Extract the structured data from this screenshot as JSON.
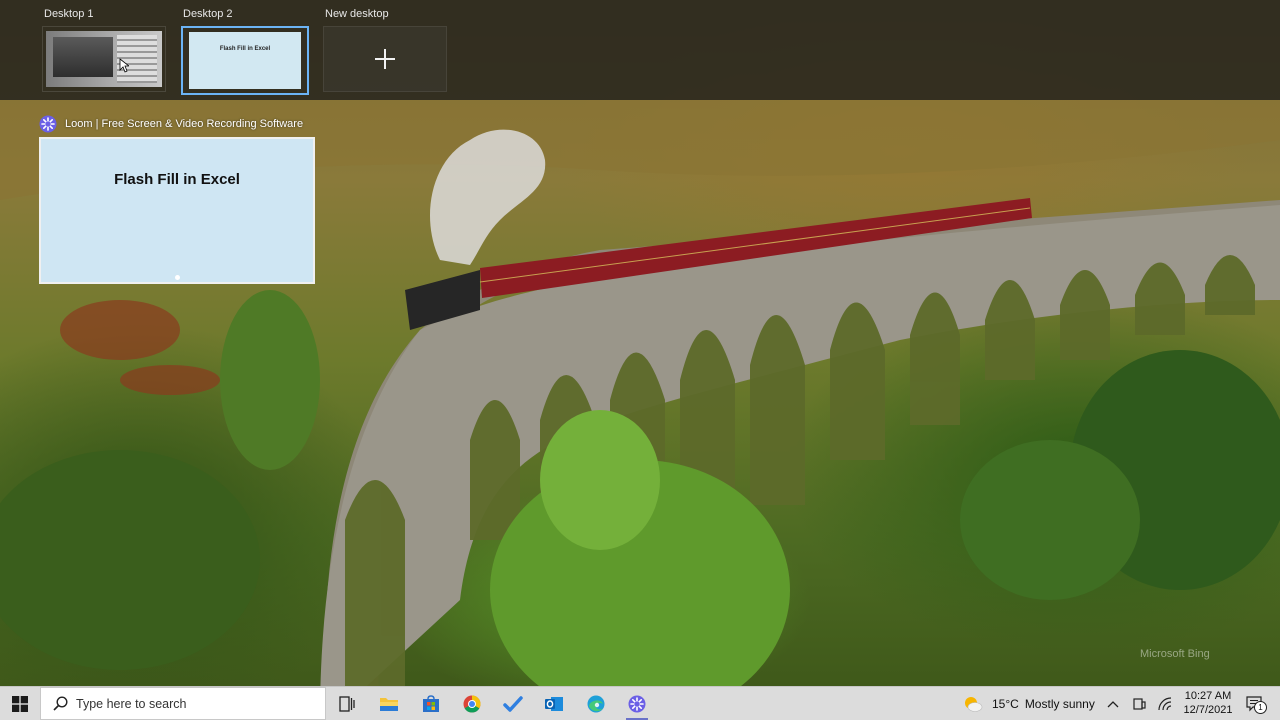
{
  "task_view": {
    "desktops": [
      {
        "label": "Desktop 1",
        "active": false
      },
      {
        "label": "Desktop 2",
        "active": true,
        "preview_text": "Flash Fill in Excel"
      }
    ],
    "new_desktop_label": "New desktop"
  },
  "window": {
    "app_icon": "loom-icon",
    "title": "Loom | Free Screen & Video Recording Software",
    "preview_text": "Flash Fill in Excel"
  },
  "wallpaper": {
    "watermark": "Microsoft Bing"
  },
  "taskbar": {
    "search_placeholder": "Type here to search",
    "apps": [
      {
        "name": "task-view-icon"
      },
      {
        "name": "file-explorer-icon"
      },
      {
        "name": "microsoft-store-icon"
      },
      {
        "name": "chrome-icon"
      },
      {
        "name": "todo-icon"
      },
      {
        "name": "outlook-icon"
      },
      {
        "name": "edge-icon"
      },
      {
        "name": "loom-icon",
        "active": true
      }
    ],
    "weather": {
      "temp": "15°C",
      "condition": "Mostly sunny"
    },
    "clock": {
      "time": "10:27 AM",
      "date": "12/7/2021"
    },
    "notification_count": "1"
  },
  "colors": {
    "accent_border": "#6cb4f5",
    "taskbar_bg": "#dcdcdc",
    "preview_bg": "#cfe6f3"
  }
}
